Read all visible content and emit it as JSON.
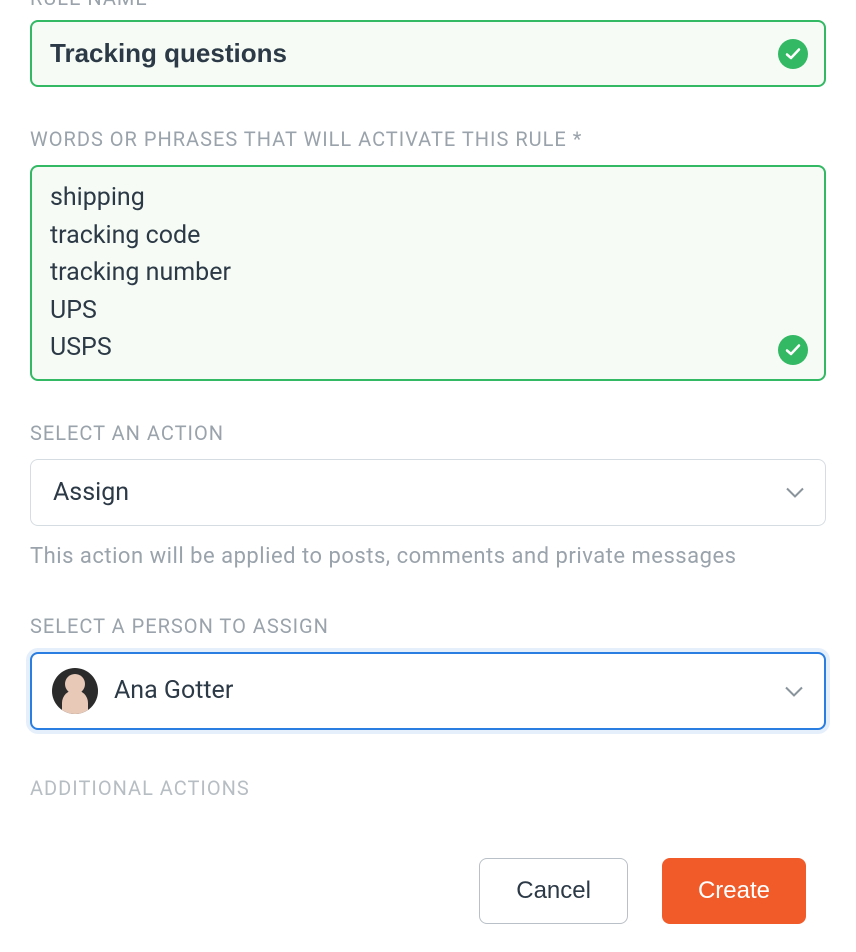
{
  "labels": {
    "ruleName": "RULE NAME",
    "words": "WORDS OR PHRASES THAT WILL ACTIVATE THIS RULE *",
    "action": "SELECT AN ACTION",
    "person": "SELECT A PERSON TO ASSIGN",
    "additional": "ADDITIONAL ACTIONS"
  },
  "ruleName": {
    "value": "Tracking questions"
  },
  "words": {
    "value": "shipping\ntracking code\ntracking number\nUPS\nUSPS"
  },
  "action": {
    "selected": "Assign",
    "helper": "This action will be applied to posts, comments and private messages"
  },
  "person": {
    "selected": "Ana Gotter"
  },
  "footer": {
    "cancel": "Cancel",
    "create": "Create"
  }
}
